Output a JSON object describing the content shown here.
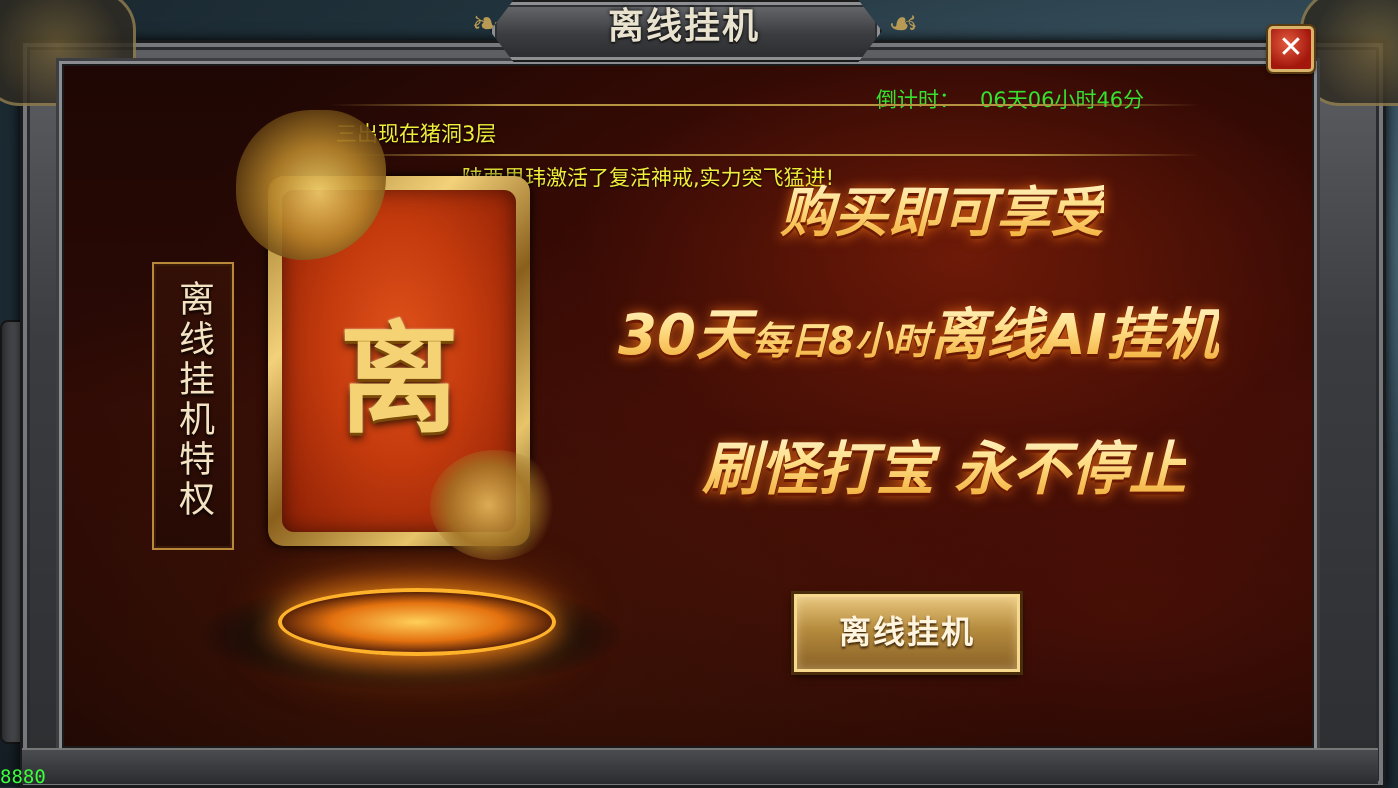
{
  "window": {
    "title": "离线挂机",
    "close_symbol": "✕"
  },
  "countdown": {
    "label": "倒计时：",
    "value": "06天06小时46分"
  },
  "announcements": [
    "三出现在猪洞3层",
    "陕西思玮激活了复活神戒,实力突飞猛进!"
  ],
  "privilege": {
    "label": "离线挂机特权",
    "card_char": "离"
  },
  "promo": {
    "line1": "购买即可享受",
    "line2_a": "30天",
    "line2_b": "每日8小时",
    "line2_c": "离线AI挂机",
    "line3": "刷怪打宝  永不停止"
  },
  "action_button": {
    "label": "离线挂机"
  },
  "corner_stat": "8880",
  "colors": {
    "countdown": "#35e22f",
    "announcement": "#f0ee3a",
    "gold": "#f5d274"
  }
}
